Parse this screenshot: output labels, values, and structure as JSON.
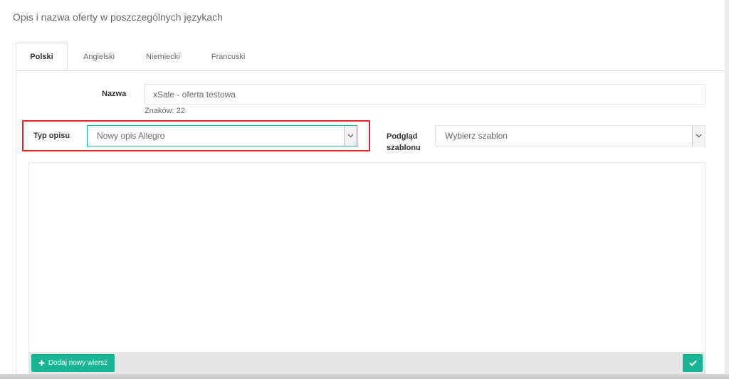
{
  "panel": {
    "title": "Opis i nazwa oferty w poszczególnych językach"
  },
  "tabs": [
    {
      "label": "Polski",
      "active": true
    },
    {
      "label": "Angielski",
      "active": false
    },
    {
      "label": "Niemiecki",
      "active": false
    },
    {
      "label": "Francuski",
      "active": false
    }
  ],
  "form": {
    "name_label": "Nazwa",
    "name_value": "xSale - oferta testowa",
    "char_count": "Znaków: 22",
    "description_type_label": "Typ opisu",
    "description_type_value": "Nowy opis Allegro",
    "template_preview_label_line1": "Podgląd",
    "template_preview_label_line2": "szablonu",
    "template_value": "Wybierz szablon"
  },
  "footer": {
    "add_row_label": "Dodaj nowy wiersz"
  },
  "colors": {
    "accent": "#1ab394",
    "highlight": "#d9262e"
  }
}
